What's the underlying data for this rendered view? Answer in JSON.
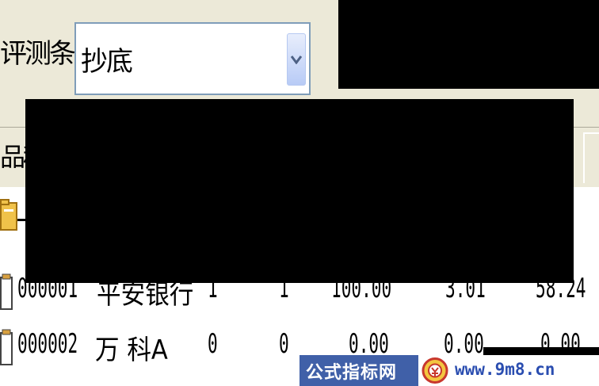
{
  "filter": {
    "label": "评测条件:",
    "selected": "抄底"
  },
  "table": {
    "header_partial": "品种",
    "group_row_marker": "-",
    "rows": [
      {
        "code": "000001",
        "name": "平安银行",
        "c1": "1",
        "c2": "1",
        "c3": "100.00",
        "c4": "3.01",
        "c5": "58.24"
      },
      {
        "code": "000002",
        "name": "万 科A",
        "c1": "0",
        "c2": "0",
        "c3": "0.00",
        "c4": "0.00",
        "c5": "0.00"
      }
    ]
  },
  "watermark": {
    "site_name": "公式指标网",
    "url": "www.9m8.cn",
    "logo_icon": "coin-logo-icon"
  },
  "colors": {
    "toolbar_bg": "#ece9d8",
    "combo_border": "#7f9db9",
    "watermark_blue": "#4060a8",
    "url_blue": "#2a4db0"
  }
}
